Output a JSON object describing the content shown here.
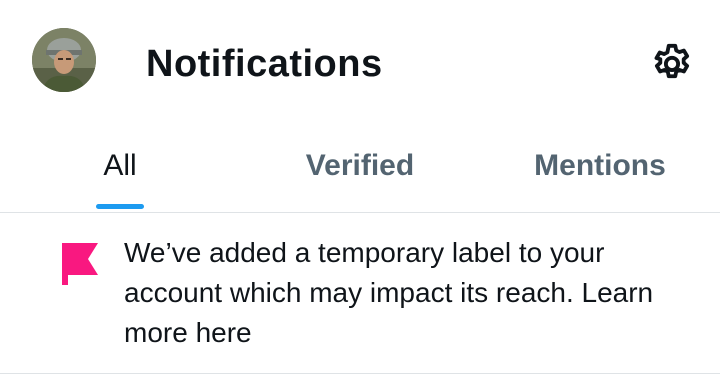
{
  "header": {
    "title": "Notifications",
    "avatar_icon": "profile-avatar",
    "settings_icon": "gear-icon"
  },
  "tabs": [
    {
      "label": "All",
      "active": true
    },
    {
      "label": "Verified",
      "active": false
    },
    {
      "label": "Mentions",
      "active": false
    }
  ],
  "notice": {
    "icon": "flag-icon",
    "icon_color": "#f91880",
    "text": "We’ve added a temporary label to your account which may impact its reach. Learn more here"
  },
  "colors": {
    "accent": "#1d9bf0",
    "text_primary": "#0f1419",
    "text_secondary": "#536471",
    "divider": "#dfe3e6"
  }
}
